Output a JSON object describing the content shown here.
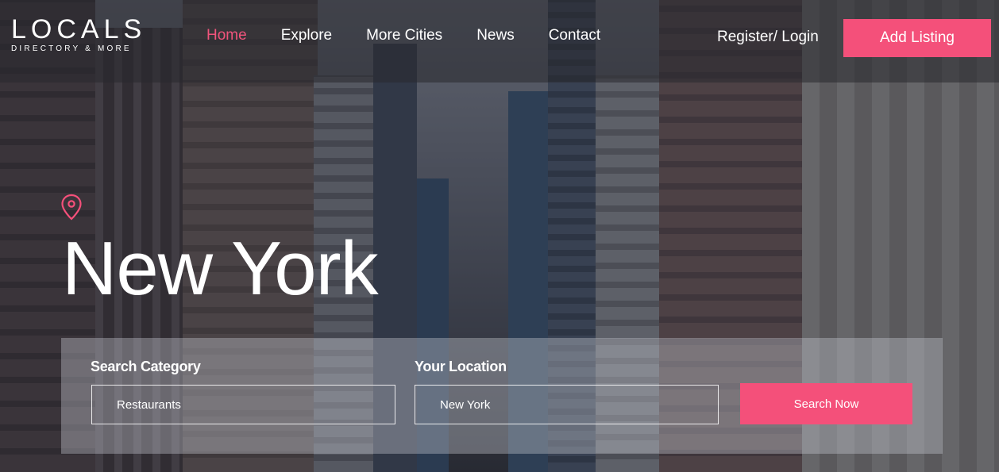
{
  "brand": {
    "name": "LOCALS",
    "tagline": "DIRECTORY & MORE"
  },
  "nav": {
    "items": [
      {
        "label": "Home",
        "active": true
      },
      {
        "label": "Explore",
        "active": false
      },
      {
        "label": "More Cities",
        "active": false
      },
      {
        "label": "News",
        "active": false
      },
      {
        "label": "Contact",
        "active": false
      }
    ],
    "login_label": "Register/ Login",
    "add_listing_label": "Add Listing"
  },
  "hero": {
    "location_icon": "map-pin-icon",
    "title": "New York"
  },
  "search": {
    "category_label": "Search Category",
    "category_value": "Restaurants",
    "location_label": "Your Location",
    "location_value": "New York",
    "button_label": "Search Now"
  },
  "colors": {
    "accent": "#f4507a",
    "text": "#ffffff"
  }
}
